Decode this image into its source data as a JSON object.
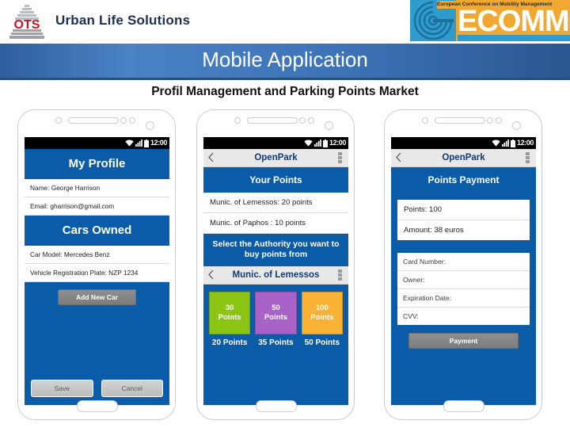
{
  "header": {
    "brand": "Urban Life Solutions",
    "logo_text": "OTS",
    "ecomm": {
      "tagline": "European Conference on Mobility Management",
      "wordmark": "ECOMM"
    }
  },
  "banner": {
    "title": "Mobile Application",
    "subtitle": "Profil Management and Parking Points Market"
  },
  "colors": {
    "app_blue": "#0a5ba8",
    "banner_blue": "#3b72b5",
    "ecomm_orange": "#f0a830",
    "ecomm_cyan": "#2e9ccc",
    "logo_red": "#cc1122",
    "tile_green": "#8cc414",
    "tile_purple": "#a862c8",
    "tile_orange": "#f9b233"
  },
  "status_bar": {
    "time": "12:00",
    "icons": [
      "wifi-icon",
      "signal-icon",
      "battery-icon"
    ]
  },
  "phone1": {
    "title": "My Profile",
    "profile_rows": [
      "Name:  George Harrison",
      "Email: gharrison@gmail.com"
    ],
    "cars_title": "Cars Owned",
    "car_rows": [
      "Car Model: Mercedes Benz",
      "Vehicle Registration Plate: NZP 1234"
    ],
    "add_car_label": "Add New Car",
    "save_label": "Save",
    "cancel_label": "Cancel"
  },
  "phone2": {
    "app_title": "OpenPark",
    "points_title": "Your Points",
    "point_rows": [
      "Munic. of Lemessos:  20 points",
      "Munic. of Paphos     :  10 points"
    ],
    "select_prompt": "Select the Authority you want to buy points from",
    "authority": "Munic. of Lemessos",
    "tiles": [
      {
        "amount": "30",
        "unit": "Points",
        "color": "#8cc414",
        "price": "20 Points"
      },
      {
        "amount": "50",
        "unit": "Points",
        "color": "#a862c8",
        "price": "35 Points"
      },
      {
        "amount": "100",
        "unit": "Points",
        "color": "#f9b233",
        "price": "50 Points"
      }
    ]
  },
  "phone3": {
    "app_title": "OpenPark",
    "title": "Points Payment",
    "summary_rows": [
      "Points:  100",
      "Amount: 38 euros"
    ],
    "card_fields": [
      "Card Number:",
      "Owner:",
      "Expiration Date:",
      "CVV:"
    ],
    "payment_label": "Payment"
  }
}
